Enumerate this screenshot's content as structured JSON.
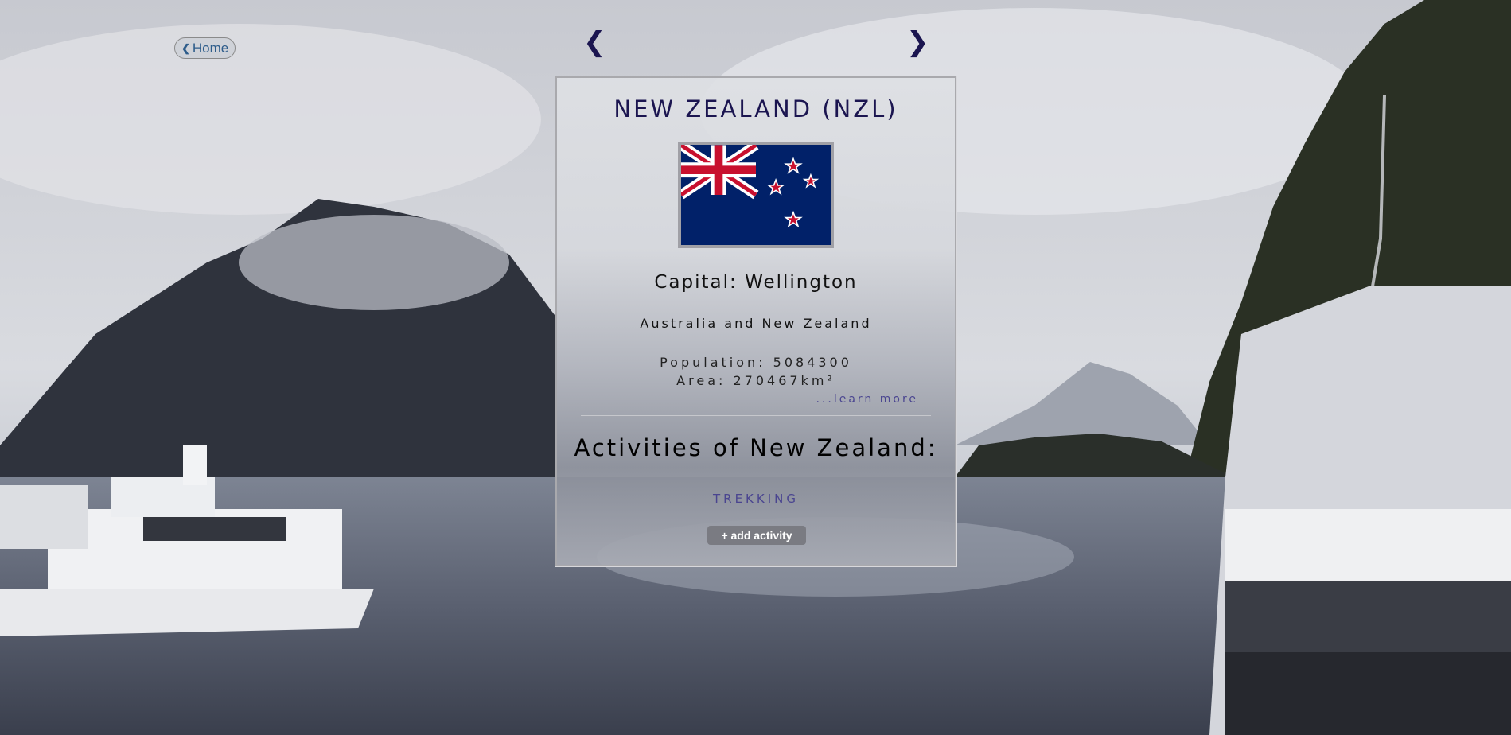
{
  "nav": {
    "home_label": "Home",
    "prev_symbol": "❮",
    "next_symbol": "❯"
  },
  "country": {
    "title": "NEW ZEALAND (NZL)",
    "capital": "Capital: Wellington",
    "region": "Australia and New Zealand",
    "population": "Population: 5084300",
    "area": "Area: 270467km²",
    "learn_more": "...learn more"
  },
  "activities": {
    "heading": "Activities of New Zealand:",
    "items": [
      "TREKKING"
    ],
    "add_label": "+ add activity"
  },
  "colors": {
    "title": "#1b1550",
    "link": "#4a4590",
    "flag_blue": "#012169",
    "flag_red": "#C8102E"
  }
}
